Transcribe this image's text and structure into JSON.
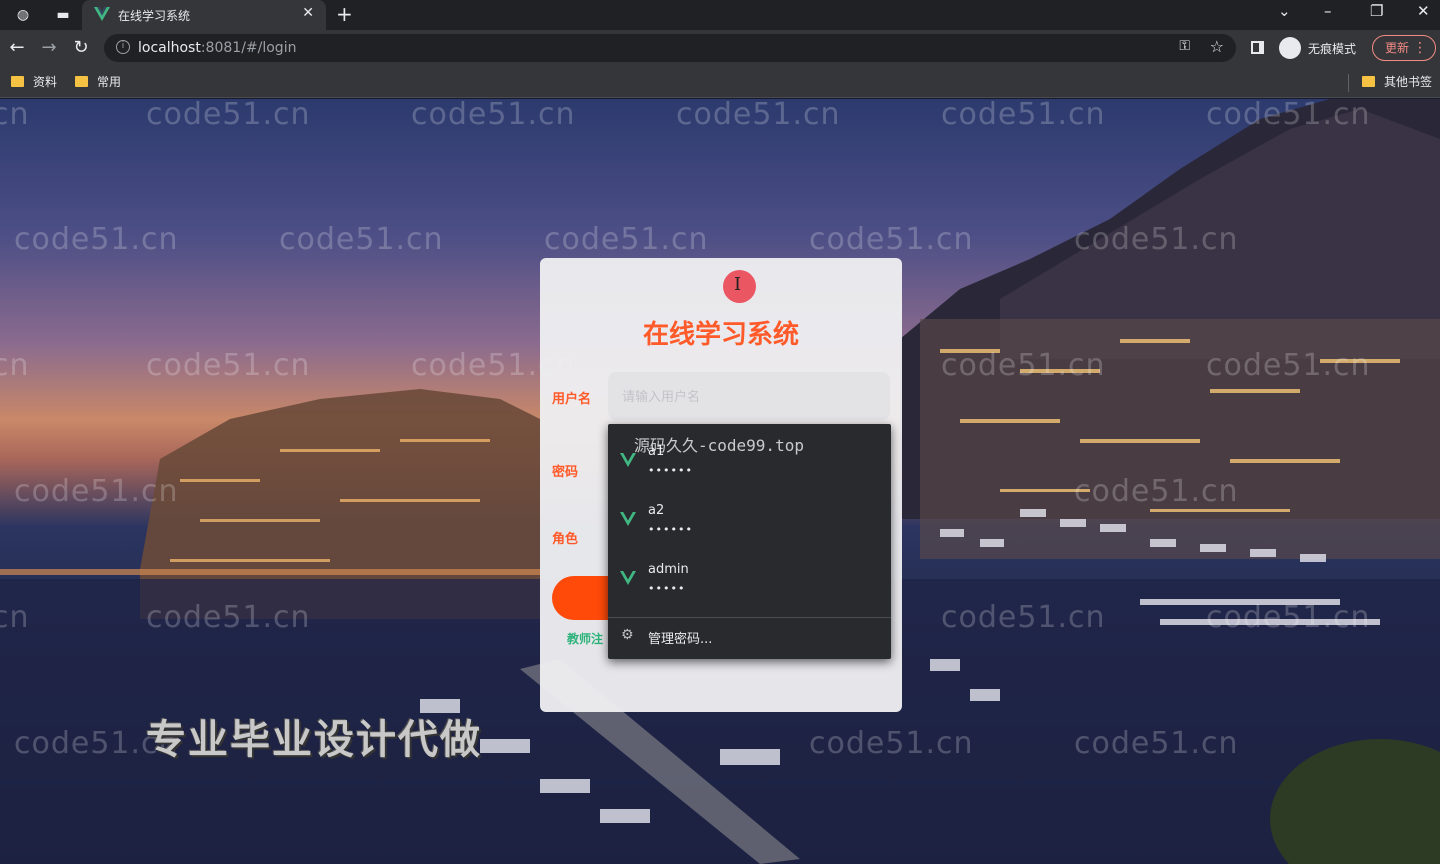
{
  "browser": {
    "tab_title": "在线学习系统",
    "url_host": "localhost",
    "url_rest": ":8081/#/login",
    "incognito_label": "无痕模式",
    "update_label": "更新",
    "bookmarks": [
      "资料",
      "常用"
    ],
    "other_bookmarks": "其他书签"
  },
  "login": {
    "title": "在线学习系统",
    "username_label": "用户名",
    "username_placeholder": "请输入用户名",
    "password_label": "密码",
    "role_label": "角色",
    "register_link": "教师注"
  },
  "autofill": {
    "overlay_text": "源码久久-code99.top",
    "accounts": [
      {
        "username": "a1",
        "password_mask": "••••••"
      },
      {
        "username": "a2",
        "password_mask": "••••••"
      },
      {
        "username": "admin",
        "password_mask": "•••••"
      }
    ],
    "manage_label": "管理密码...",
    "accent_color": "#41b883"
  },
  "overlay": {
    "watermark": "code51.cn",
    "watermark_fragment": "cn",
    "promo": "专业毕业设计代做"
  },
  "colors": {
    "brand_orange": "#ff5a2a",
    "button_orange": "#ff4a0a",
    "register_green": "#2db37a"
  }
}
